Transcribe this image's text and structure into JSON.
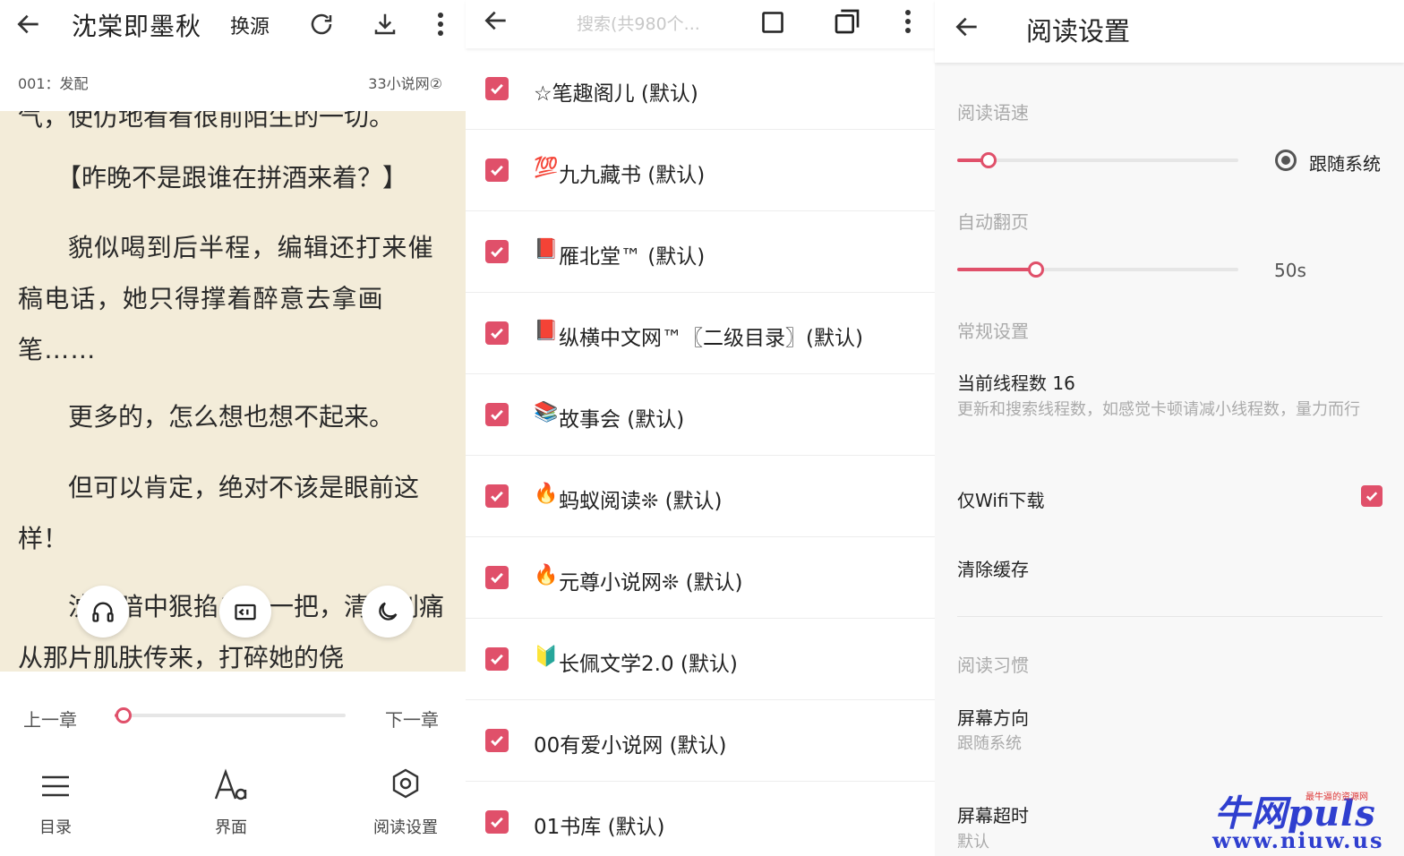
{
  "reader": {
    "title": "沈棠即墨秋",
    "swap_source": "换源",
    "chapter": "001：发配",
    "source_name": "33小说网②",
    "paragraphs": [
      "气，使仿地看看很前陌生的一切。",
      "【昨晚不是跟谁在拼酒来着？】",
      "貌似喝到后半程，编辑还打来催稿电话，她只得撑着醉意去拿画笔……",
      "更多的，怎么想也想不起来。",
      "但可以肯定，绝对不该是眼前这样！",
      "沈棠暗中狠掐自己一把，清晰刺痛从那片肌肤传来，打碎她的侥"
    ],
    "prev_chapter": "上一章",
    "next_chapter": "下一章",
    "chapter_progress": 0.04,
    "bottom": {
      "toc": "目录",
      "interface": "界面",
      "read_settings": "阅读设置"
    }
  },
  "sources": {
    "search_placeholder": "搜索(共980个...",
    "items": [
      {
        "icon": "",
        "label": "☆笔趣阁儿 (默认)",
        "checked": true
      },
      {
        "icon": "💯",
        "label": "九九藏书 (默认)",
        "checked": true
      },
      {
        "icon": "📕",
        "label": "雁北堂™ (默认)",
        "checked": true
      },
      {
        "icon": "📕",
        "label": "纵横中文网™〖二级目录〗(默认)",
        "checked": true
      },
      {
        "icon": "📚",
        "label": "故事会 (默认)",
        "checked": true
      },
      {
        "icon": "🔥",
        "label": "蚂蚁阅读❊ (默认)",
        "checked": true
      },
      {
        "icon": "🔥",
        "label": "元尊小说网❊ (默认)",
        "checked": true
      },
      {
        "icon": "🔰",
        "label": "长佩文学2.0 (默认)",
        "checked": true
      },
      {
        "icon": "",
        "label": "00有爱小说网 (默认)",
        "checked": true
      },
      {
        "icon": "",
        "label": "01书库 (默认)",
        "checked": true
      }
    ]
  },
  "settings": {
    "title": "阅读设置",
    "reading_speed_label": "阅读语速",
    "reading_speed_value": 0.11,
    "follow_system": "跟随系统",
    "auto_page_label": "自动翻页",
    "auto_page_value": 0.28,
    "auto_page_text": "50s",
    "general_label": "常规设置",
    "threads_title": "当前线程数 16",
    "threads_desc": "更新和搜索线程数，如感觉卡顿请减小线程数，量力而行",
    "wifi_only": "仅Wifi下载",
    "wifi_only_checked": true,
    "clear_cache": "清除缓存",
    "habit_label": "阅读习惯",
    "orientation_title": "屏幕方向",
    "orientation_value": "跟随系统",
    "timeout_title": "屏幕超时",
    "timeout_value": "默认"
  },
  "watermark": {
    "brand": "牛网puls",
    "url": "www.niuw.us",
    "tagline": "最牛逼的资源网"
  },
  "colors": {
    "accent": "#e0506a",
    "paper": "#f3ecd9"
  }
}
